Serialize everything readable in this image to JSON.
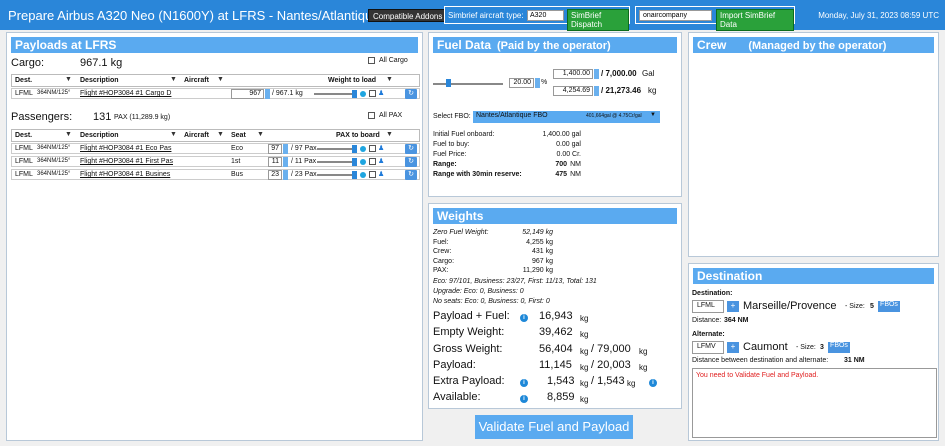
{
  "topbar": {
    "title": "Prepare Airbus A320 Neo (N1600Y) at LFRS - Nantes/Atlantique",
    "compatible_addons": "Compatible Addons",
    "simbrief_label": "Simbrief aircraft type:",
    "simbrief_value": "A320",
    "simbrief_dispatch": "SimBrief Dispatch",
    "onair_value": "onaircompany",
    "import_simbrief": "Import SimBrief Data",
    "date": "Monday, July 31, 2023 08:59 UTC"
  },
  "payloads": {
    "title": "Payloads at LFRS",
    "cargo_label": "Cargo:",
    "cargo_total": "967.1 kg",
    "all_cargo": "All Cargo",
    "cargo_headers": {
      "dest": "Dest.",
      "desc": "Description",
      "aircraft": "Aircraft",
      "weight": "Weight to load"
    },
    "cargo_rows": [
      {
        "dest": "LFML",
        "dist": "364NM/125°",
        "desc": "Flight #HOP3084 #1 Cargo D",
        "value": "967",
        "max": "/ 967.1 kg"
      }
    ],
    "pax_label": "Passengers:",
    "pax_total": "131",
    "pax_detail": "PAX (11,289.9 kg)",
    "all_pax": "All PAX",
    "pax_headers": {
      "dest": "Dest.",
      "desc": "Description",
      "aircraft": "Aircraft",
      "seat": "Seat",
      "pax": "PAX to board"
    },
    "pax_rows": [
      {
        "dest": "LFML",
        "dist": "364NM/125°",
        "desc": "Flight #HOP3084 #1 Eco Pas",
        "seat": "Eco",
        "value": "97",
        "max": "/ 97 Pax"
      },
      {
        "dest": "LFML",
        "dist": "364NM/125°",
        "desc": "Flight #HOP3084 #1 First Pas",
        "seat": "1st",
        "value": "11",
        "max": "/ 11 Pax"
      },
      {
        "dest": "LFML",
        "dist": "364NM/125°",
        "desc": "Flight #HOP3084 #1 Busines",
        "seat": "Bus",
        "value": "23",
        "max": "/ 23 Pax"
      }
    ]
  },
  "fuel": {
    "title": "Fuel Data",
    "subtitle": "(Paid by the operator)",
    "percent": "20.00",
    "pct_sign": "%",
    "gal_value": "1,400.00",
    "gal_total": "/ 7,000.00",
    "gal_unit": "Gal",
    "kg_value": "4,254.69",
    "kg_total": "/ 21,273.46",
    "kg_unit": "kg",
    "fbo_label": "Select FBO:",
    "fbo_value": "Nantes/Atlantique FBO",
    "fbo_price": "401,664gal @ 4.75Cr/gal",
    "lines": [
      {
        "label": "Initial Fuel onboard:",
        "value": "1,400.00 gal"
      },
      {
        "label": "Fuel to buy:",
        "value": "0.00 gal"
      },
      {
        "label": "Fuel Price:",
        "value": "0.00 Cr."
      }
    ],
    "range_label": "Range:",
    "range_value": "700",
    "range_unit": "NM",
    "reserve_label": "Range with 30min reserve:",
    "reserve_value": "475",
    "reserve_unit": "NM"
  },
  "weights": {
    "title": "Weights",
    "lines": [
      {
        "label": "Zero Fuel Weight:",
        "value": "52,149 kg"
      },
      {
        "label": "Fuel:",
        "value": "4,255 kg"
      },
      {
        "label": "Crew:",
        "value": "431 kg"
      },
      {
        "label": "Cargo:",
        "value": "967 kg"
      },
      {
        "label": "PAX:",
        "value": "11,290 kg"
      }
    ],
    "notes": [
      "Eco: 97/101, Business: 23/27, First: 11/13, Total: 131",
      "Upgrade: Eco: 0, Business: 0",
      "No seats: Eco: 0, Business: 0, First: 0"
    ],
    "big": [
      {
        "label": "Payload + Fuel:",
        "value": "16,943",
        "unit": "kg"
      },
      {
        "label": "Empty Weight:",
        "value": "39,462",
        "unit": "kg"
      },
      {
        "label": "Gross Weight:",
        "value": "56,404",
        "unit": "kg",
        "value2": "/ 79,000",
        "unit2": "kg"
      },
      {
        "label": "Payload:",
        "value": "11,145",
        "unit": "kg",
        "value2": "/ 20,003",
        "unit2": "kg"
      },
      {
        "label": "Extra Payload:",
        "value": "1,543",
        "unit": "kg",
        "value2": "/ 1,543",
        "unit2": "kg"
      },
      {
        "label": "Available:",
        "value": "8,859",
        "unit": "kg"
      }
    ]
  },
  "validate": "Validate Fuel and Payload",
  "crew": {
    "title": "Crew",
    "subtitle": "(Managed by the operator)"
  },
  "destination": {
    "title": "Destination",
    "dest_label": "Destination:",
    "dest_code": "LFML",
    "dest_name": "Marseille/Provence",
    "dest_size": "- Size:",
    "dest_size_val": "5",
    "fbos": "FBOs",
    "dist_label": "Distance:",
    "dist_value": "364 NM",
    "alt_label": "Alternate:",
    "alt_code": "LFMV",
    "alt_name": "Caumont",
    "alt_size": "- Size:",
    "alt_size_val": "3",
    "alt_dist_label": "Distance between destination and alternate:",
    "alt_dist_value": "31 NM",
    "plus": "+",
    "message": "You need to Validate Fuel and Payload."
  },
  "colors": {
    "accent": "#2a86d9",
    "header": "#5aaaf0",
    "green": "#2aa13a",
    "error": "#e02020"
  }
}
